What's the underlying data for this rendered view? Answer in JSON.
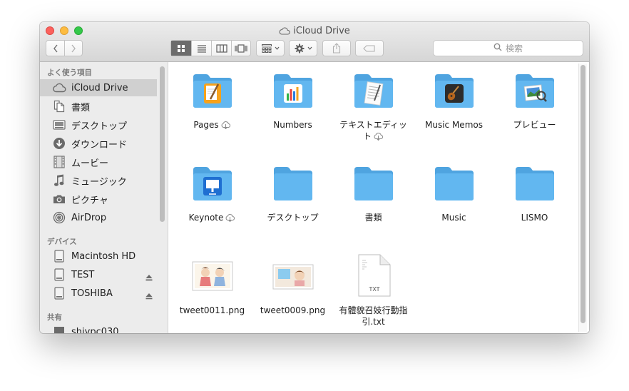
{
  "window": {
    "title": "iCloud Drive",
    "search_placeholder": "検索"
  },
  "toolbar": {
    "back_icon": "chevron-left-icon",
    "forward_icon": "chevron-right-icon",
    "views": [
      "icon-view",
      "list-view",
      "column-view",
      "cover-flow-view"
    ],
    "active_view": "icon-view",
    "arrange_icon": "arrange-grid-icon",
    "action_icon": "gear-icon",
    "share_icon": "share-icon",
    "tag_icon": "tag-icon"
  },
  "sidebar": {
    "favorites_header": "よく使う項目",
    "favorites": [
      {
        "label": "iCloud Drive",
        "icon": "cloud-icon",
        "selected": true
      },
      {
        "label": "書類",
        "icon": "documents-icon"
      },
      {
        "label": "デスクトップ",
        "icon": "desktop-icon"
      },
      {
        "label": "ダウンロード",
        "icon": "download-icon"
      },
      {
        "label": "ムービー",
        "icon": "movie-icon"
      },
      {
        "label": "ミュージック",
        "icon": "music-note-icon"
      },
      {
        "label": "ピクチャ",
        "icon": "camera-icon"
      },
      {
        "label": "AirDrop",
        "icon": "airdrop-icon"
      }
    ],
    "devices_header": "デバイス",
    "devices": [
      {
        "label": "Macintosh HD",
        "icon": "hard-drive-icon"
      },
      {
        "label": "TEST",
        "icon": "drive-icon",
        "ejectable": true
      },
      {
        "label": "TOSHIBA",
        "icon": "drive-icon",
        "ejectable": true
      }
    ],
    "shared_header": "共有",
    "shared": [
      {
        "label": "shiypc030",
        "icon": "network-computer-icon"
      }
    ]
  },
  "files": [
    {
      "name": "Pages",
      "kind": "app-folder",
      "badge": "pages-icon",
      "cloud": true
    },
    {
      "name": "Numbers",
      "kind": "app-folder",
      "badge": "numbers-icon"
    },
    {
      "name_line1": "テキストエディッ",
      "name_line2": "ト",
      "kind": "app-folder",
      "badge": "textedit-icon",
      "cloud": true
    },
    {
      "name": "Music Memos",
      "kind": "app-folder",
      "badge": "guitar-icon"
    },
    {
      "name": "プレビュー",
      "kind": "app-folder",
      "badge": "preview-icon"
    },
    {
      "name": "Keynote",
      "kind": "app-folder",
      "badge": "keynote-icon",
      "cloud": true
    },
    {
      "name": "デスクトップ",
      "kind": "folder"
    },
    {
      "name": "書類",
      "kind": "folder"
    },
    {
      "name": "Music",
      "kind": "folder"
    },
    {
      "name": "LISMO",
      "kind": "folder"
    },
    {
      "name": "tweet0011.png",
      "kind": "image"
    },
    {
      "name": "tweet0009.png",
      "kind": "image"
    },
    {
      "name_line1": "有體貌召妓行動指",
      "name_line2": "引.txt",
      "kind": "text",
      "doc_label": "TXT"
    }
  ],
  "colors": {
    "folder": "#62b7f0",
    "folder_tab": "#4fa4e0",
    "selected_sidebar": "#d0d0d0"
  }
}
